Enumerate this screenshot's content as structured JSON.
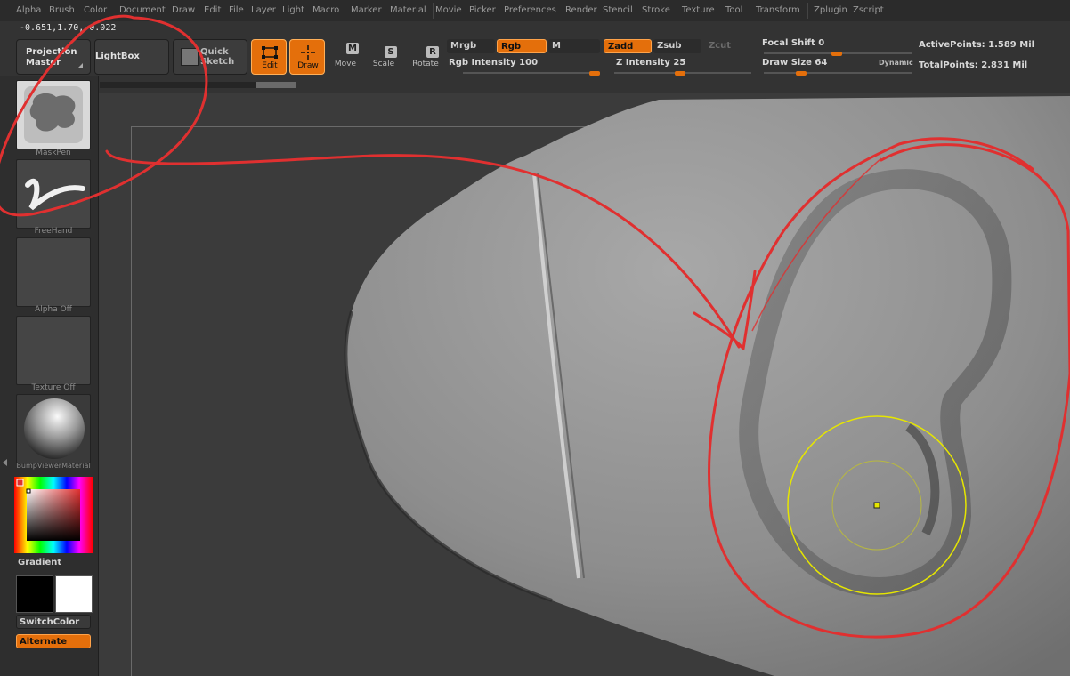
{
  "menu": {
    "items": [
      "Alpha",
      "Brush",
      "Color",
      "Document",
      "Draw",
      "Edit",
      "File",
      "Layer",
      "Light",
      "Macro",
      "Marker",
      "Material",
      "Movie",
      "Picker",
      "Preferences",
      "Render",
      "Stencil",
      "Stroke",
      "Texture",
      "Tool",
      "Transform",
      "Zplugin",
      "Zscript"
    ]
  },
  "coords": "-0.651,1.70,-0.022",
  "toolbar": {
    "projection_master": "Projection\nMaster",
    "lightbox": "LightBox",
    "quick_sketch": "Quick\nSketch",
    "edit": "Edit",
    "draw": "Draw",
    "move": "Move",
    "scale": "Scale",
    "rotate": "Rotate",
    "move_key": "M",
    "scale_key": "S",
    "rotate_key": "R",
    "mrgb": "Mrgb",
    "rgb": "Rgb",
    "m": "M",
    "zadd": "Zadd",
    "zsub": "Zsub",
    "zcut": "Zcut",
    "rgb_intensity_label": "Rgb Intensity 100",
    "z_intensity_label": "Z Intensity 25",
    "focal_shift_label": "Focal Shift 0",
    "draw_size_label": "Draw Size 64",
    "dynamic": "Dynamic",
    "active_points": "ActivePoints: 1.589 Mil",
    "total_points": "TotalPoints: 2.831 Mil"
  },
  "sliders": {
    "rgb_intensity": 100,
    "z_intensity": 25,
    "focal_shift": 0,
    "draw_size": 64
  },
  "left": {
    "brush_label": "MaskPen",
    "stroke_label": "FreeHand",
    "alpha_label": "Alpha Off",
    "texture_label": "Texture Off",
    "material_label": "BumpViewerMaterial",
    "gradient_label": "Gradient",
    "switch_color": "SwitchColor",
    "alternate": "Alternate"
  },
  "colors": {
    "accent": "#e46f0b",
    "annotation": "#e03030",
    "brush_cursor": "#e6e600",
    "primary_swatch": "#000000",
    "secondary_swatch": "#ffffff"
  }
}
